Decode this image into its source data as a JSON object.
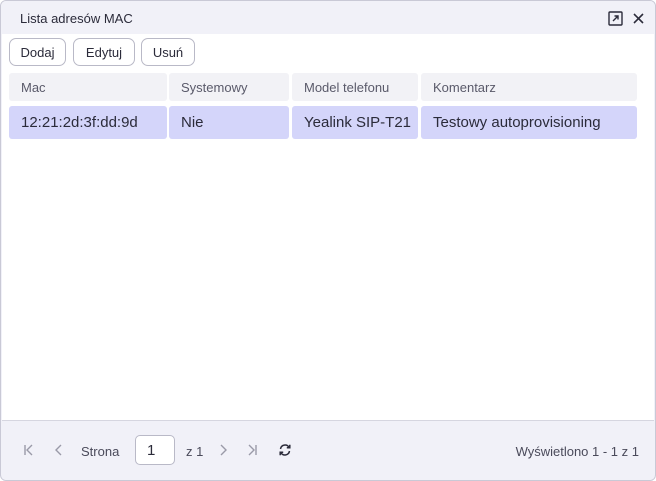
{
  "window": {
    "title": "Lista adresów MAC",
    "icons": [
      "open-external-icon",
      "close-icon"
    ]
  },
  "toolbar": {
    "add_label": "Dodaj",
    "edit_label": "Edytuj",
    "delete_label": "Usuń"
  },
  "grid": {
    "columns": [
      "Mac",
      "Systemowy",
      "Model telefonu",
      "Komentarz"
    ],
    "rows": [
      [
        "12:21:2d:3f:dd:9d",
        "Nie",
        "Yealink SIP-T21",
        "Testowy autoprovisioning"
      ]
    ],
    "selected_row_color": "#d4d5fa"
  },
  "pager": {
    "page_label": "Strona",
    "page_value": "1",
    "of_total": "z 1",
    "summary": "Wyświetlono 1 - 1 z 1",
    "icons": [
      "first-page-icon",
      "prev-page-icon",
      "next-page-icon",
      "last-page-icon",
      "refresh-icon"
    ]
  }
}
